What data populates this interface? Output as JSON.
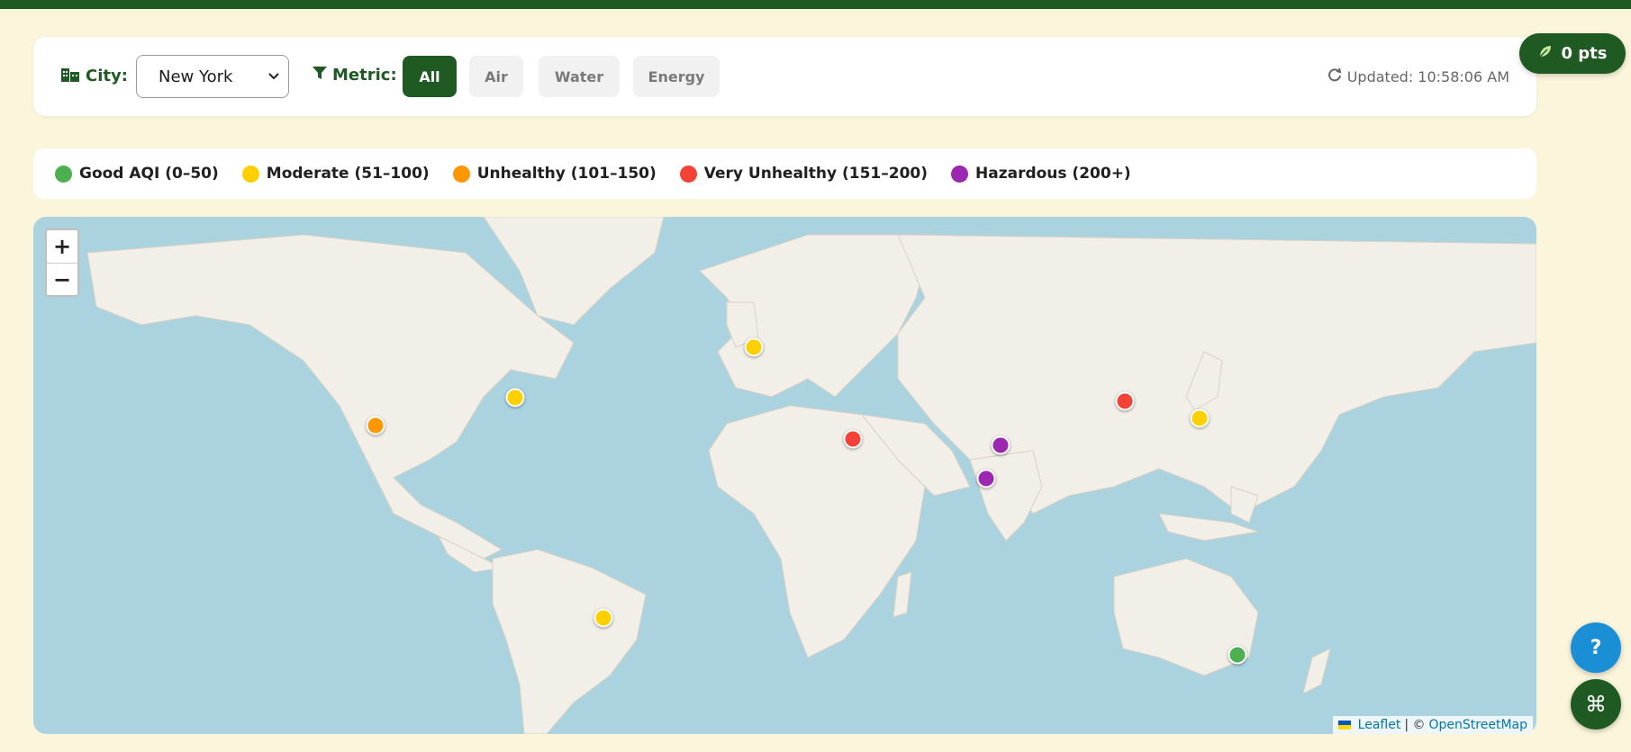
{
  "controls": {
    "city_label": "City:",
    "city_value": "New York",
    "metric_label": "Metric:",
    "metrics": [
      "All",
      "Air",
      "Water",
      "Energy"
    ],
    "active_metric": "All",
    "updated_text": "Updated: 10:58:06 AM"
  },
  "points_badge": "0 pts",
  "legend": [
    {
      "label": "Good AQI (0–50)",
      "color": "#4caf50"
    },
    {
      "label": "Moderate (51–100)",
      "color": "#ffd000"
    },
    {
      "label": "Unhealthy (101–150)",
      "color": "#ff9800"
    },
    {
      "label": "Very Unhealthy (151–200)",
      "color": "#f44336"
    },
    {
      "label": "Hazardous (200+)",
      "color": "#9c27b0"
    }
  ],
  "map": {
    "zoom_in": "+",
    "zoom_out": "−",
    "attribution_leaflet": "Leaflet",
    "attribution_sep": "| ©",
    "attribution_osm": "OpenStreetMap",
    "markers": [
      {
        "city": "Los Angeles",
        "category": "Unhealthy",
        "color": "#ff9800"
      },
      {
        "city": "New York",
        "category": "Moderate",
        "color": "#ffd000"
      },
      {
        "city": "London",
        "category": "Moderate",
        "color": "#ffd000"
      },
      {
        "city": "Cairo",
        "category": "Very Unhealthy",
        "color": "#f44336"
      },
      {
        "city": "Delhi",
        "category": "Hazardous",
        "color": "#9c27b0"
      },
      {
        "city": "Mumbai",
        "category": "Hazardous",
        "color": "#9c27b0"
      },
      {
        "city": "Beijing",
        "category": "Very Unhealthy",
        "color": "#f44336"
      },
      {
        "city": "Tokyo",
        "category": "Moderate",
        "color": "#ffd000"
      },
      {
        "city": "Rio de Janeiro",
        "category": "Moderate",
        "color": "#ffd000"
      },
      {
        "city": "Sydney",
        "category": "Good",
        "color": "#4caf50"
      }
    ]
  },
  "help_button": "?",
  "command_button": "⌘",
  "colors": {
    "brand": "#1e5a22",
    "background": "#fbf5dc",
    "water": "#aad3df",
    "land": "#f2efe9"
  }
}
